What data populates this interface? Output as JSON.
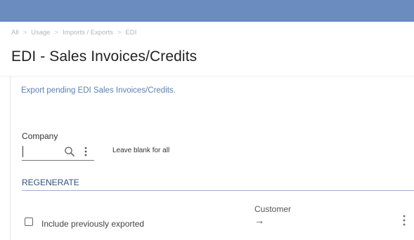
{
  "breadcrumb": [
    "All",
    "Usage",
    "Imports / Exports",
    "EDI"
  ],
  "breadcrumb_separator": ">",
  "page": {
    "title": "EDI - Sales Invoices/Credits",
    "description": "Export pending EDI Sales Invoices/Credits."
  },
  "company": {
    "label": "Company",
    "value": "",
    "hint": "Leave blank for all",
    "icons": [
      "search-icon",
      "more-options-icon"
    ]
  },
  "regenerate": {
    "section_title": "REGENERATE",
    "include_previously_exported": {
      "label": "Include previously exported",
      "checked": false
    },
    "customer": {
      "label": "Customer",
      "arrow": "→"
    }
  },
  "colors": {
    "top_bar": "#6a8cbe",
    "accent_text": "#5b7fb5",
    "section_title": "#2f4f7f",
    "section_line": "#9db1cf"
  }
}
